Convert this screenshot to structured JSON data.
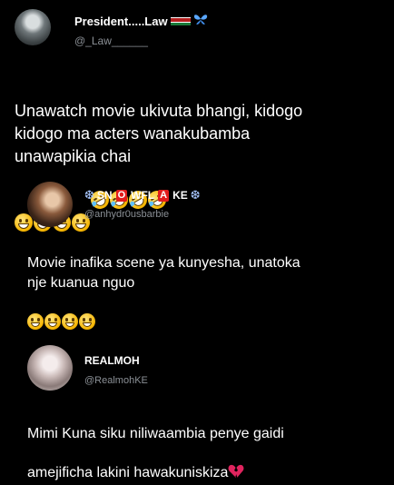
{
  "tweet1": {
    "name": "President.....Law",
    "handle": "@_Law______",
    "text": "Unawatch movie ukivuta bhangi, kidogo\nkidogo ma acters wanakubamba\nunawapikia chai",
    "name_icons": [
      "flag-icon",
      "butterfly-icon"
    ],
    "emoji": [
      "grin",
      "grin",
      "grin",
      "grin",
      "rofl",
      "rofl",
      "rofl",
      "rofl"
    ]
  },
  "tweet2": {
    "name_parts": [
      "SN",
      "O",
      "WFL",
      "A",
      "KE"
    ],
    "handle": "@anhydr0usbarbie",
    "text": "Movie inafika scene ya kunyesha, unatoka\nnje kuanua nguo",
    "emoji": [
      "grin",
      "grin",
      "grin",
      "grin"
    ]
  },
  "tweet3": {
    "name": "REALMOH",
    "handle": "@RealmohKE",
    "text": "Mimi Kuna siku niliwaambia penye gaidi\namejificha lakini hawakuniskiza",
    "emoji_end": "broken-heart-icon"
  },
  "colors": {
    "background": "#000000",
    "text": "#ffffff",
    "handle": "#8b9096",
    "accent_red": "#e21c1c",
    "heart": "#e0245e",
    "snowflake": "#a9c7ff"
  }
}
